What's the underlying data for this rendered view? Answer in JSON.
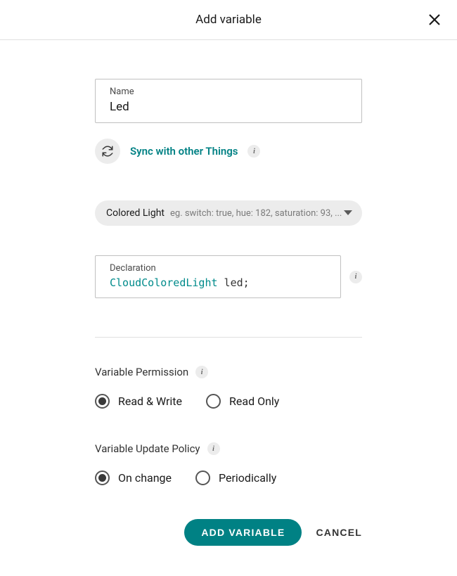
{
  "dialog": {
    "title": "Add variable"
  },
  "name_field": {
    "label": "Name",
    "value": "Led"
  },
  "sync": {
    "label": "Sync with other Things"
  },
  "type_select": {
    "selected": "Colored Light",
    "hint": "eg. switch: true, hue: 182, saturation: 93, ..."
  },
  "declaration": {
    "label": "Declaration",
    "type_token": "CloudColoredLight",
    "var_token": " led;"
  },
  "permission": {
    "label": "Variable Permission",
    "options": {
      "rw": "Read & Write",
      "ro": "Read Only"
    },
    "selected": "rw"
  },
  "update_policy": {
    "label": "Variable Update Policy",
    "options": {
      "onchange": "On change",
      "periodic": "Periodically"
    },
    "selected": "onchange"
  },
  "buttons": {
    "primary": "ADD VARIABLE",
    "secondary": "CANCEL"
  }
}
